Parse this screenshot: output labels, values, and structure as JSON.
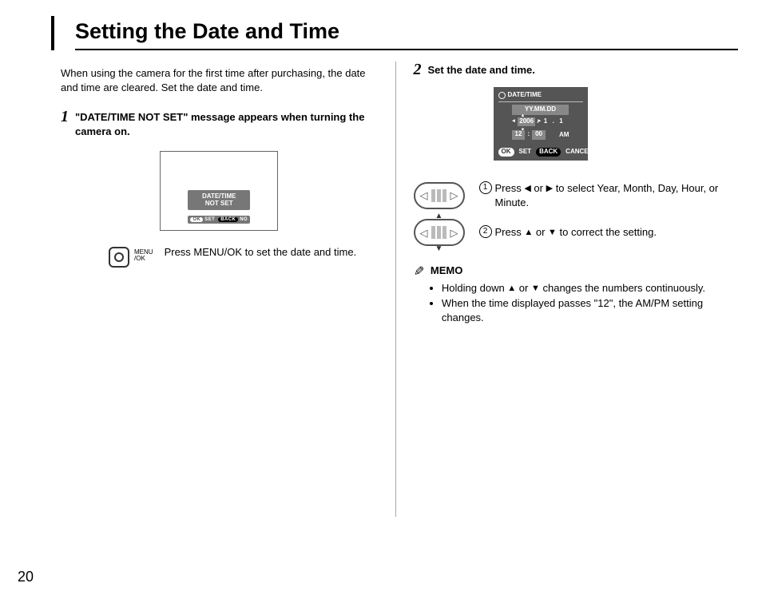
{
  "page": {
    "number": "20",
    "title": "Setting the Date and Time"
  },
  "intro": "When using the camera for the first time after purchasing, the date and time are cleared. Set the date and time.",
  "step1": {
    "num": "1",
    "title": "\"DATE/TIME NOT SET\" message appears when turning the camera on.",
    "lcd_msg_line1": "DATE/TIME",
    "lcd_msg_line2": "NOT SET",
    "lcd_bar_ok": "OK",
    "lcd_bar_set": "SET",
    "lcd_bar_back": "BACK",
    "lcd_bar_no": "NO",
    "menu_label_line1": "MENU",
    "menu_label_line2": "/OK",
    "instruction": "Press MENU/OK to set the date and time."
  },
  "step2": {
    "num": "2",
    "title": "Set the date and time.",
    "lcd_header": "DATE/TIME",
    "lcd_format": "YY.MM.DD",
    "lcd_year": "2006",
    "lcd_month": "1",
    "lcd_day": "1",
    "lcd_hour": "12",
    "lcd_min": "00",
    "lcd_ampm": "AM",
    "lcd_ok": "OK",
    "lcd_set": "SET",
    "lcd_back": "BACK",
    "lcd_cancel": "CANCEL",
    "sub1_num": "1",
    "sub1_text_a": "Press ",
    "sub1_text_b": " or ",
    "sub1_text_c": " to select Year, Month, Day, Hour, or Minute.",
    "sub2_num": "2",
    "sub2_text_a": "Press ",
    "sub2_text_b": " or ",
    "sub2_text_c": " to correct the setting."
  },
  "memo": {
    "title": "MEMO",
    "item1_a": "Holding down ",
    "item1_b": " or ",
    "item1_c": " changes the numbers continuously.",
    "item2": "When the time displayed passes \"12\", the AM/PM setting changes."
  }
}
